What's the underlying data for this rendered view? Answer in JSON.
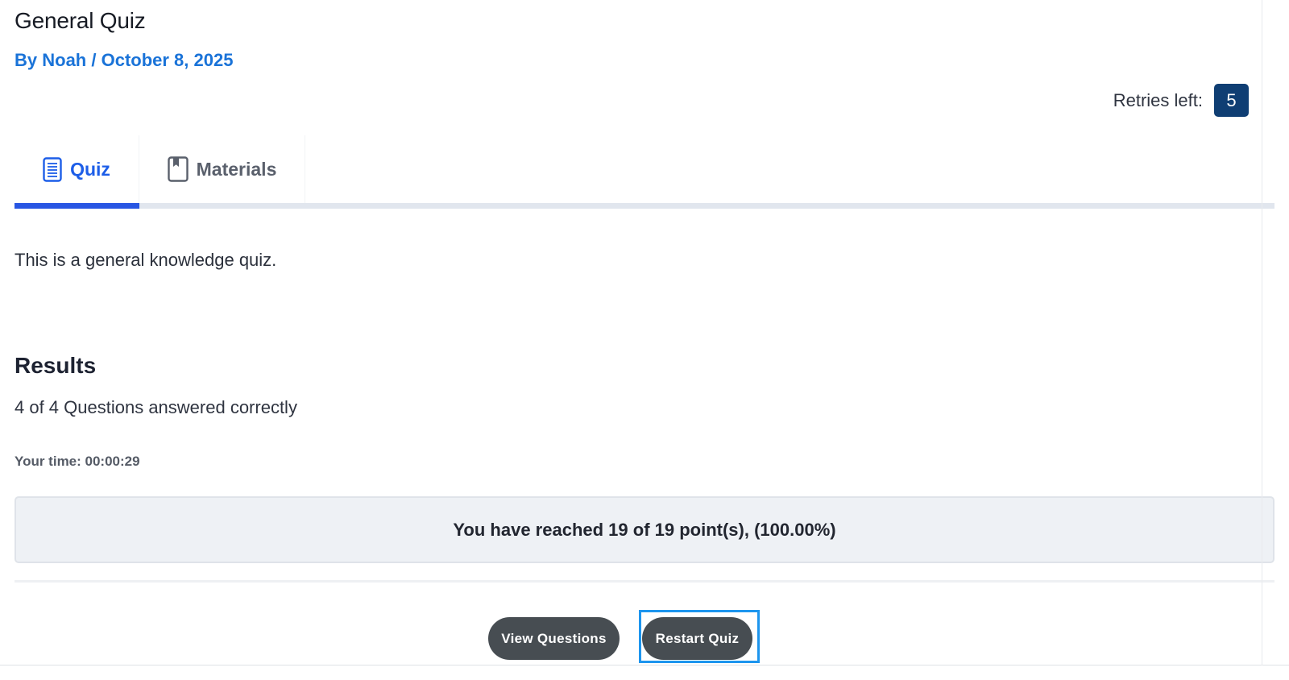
{
  "header": {
    "title": "General Quiz",
    "byline_prefix": "By ",
    "author": "Noah",
    "separator": " / ",
    "date": "October 8, 2025",
    "retries_label": "Retries left:",
    "retries_count": "5"
  },
  "tabs": [
    {
      "label": "Quiz",
      "icon": "document-lines-icon",
      "active": true
    },
    {
      "label": "Materials",
      "icon": "bookmark-book-icon",
      "active": false
    }
  ],
  "content": {
    "description": "This is a general knowledge quiz.",
    "results_heading": "Results",
    "answered_text": "4 of 4 Questions answered correctly",
    "time_text": "Your time: 00:00:29",
    "score_text": "You have reached 19 of 19 point(s), (100.00%)"
  },
  "actions": {
    "view_questions_label": "View Questions",
    "restart_quiz_label": "Restart Quiz"
  },
  "colors": {
    "accent": "#1d5ee8",
    "link": "#1a73d8",
    "badge": "#0f3e73",
    "button": "#474d52",
    "focus": "#1d95ee"
  }
}
